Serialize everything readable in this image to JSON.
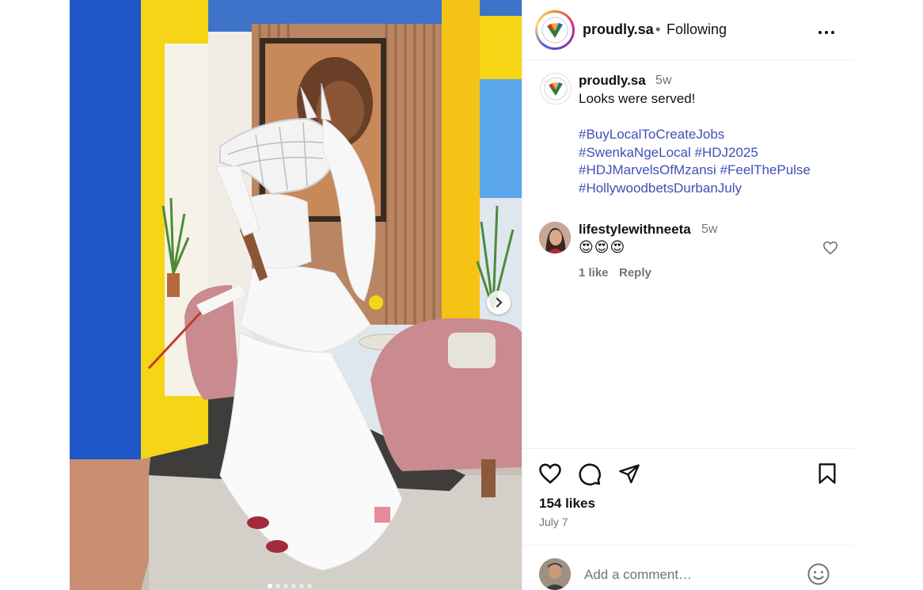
{
  "post": {
    "carousel_dots": 6,
    "active_dot": 0
  },
  "header": {
    "username": "proudly.sa",
    "separator": "•",
    "follow_status": "Following"
  },
  "caption": {
    "username": "proudly.sa",
    "time": "5w",
    "text": "Looks were served!",
    "hashtags": [
      "#BuyLocalToCreateJobs",
      "#SwenkaNgeLocal",
      "#HDJ2025",
      "#HDJMarvelsOfMzansi",
      "#FeelThePulse",
      "#HollywoodbetsDurbanJuly"
    ]
  },
  "comment": {
    "username": "lifestylewithneeta",
    "time": "5w",
    "text": "😍😍😍",
    "likes": "1 like",
    "reply": "Reply"
  },
  "actions": {
    "likes": "154 likes",
    "date": "July 7"
  },
  "add_comment": {
    "placeholder": "Add a comment…"
  },
  "icons": {
    "like": "heart-icon",
    "comment": "comment-icon",
    "share": "send-icon",
    "save": "bookmark-icon",
    "emoji": "emoji-icon",
    "more": "more-icon",
    "next": "chevron-right-icon"
  },
  "colors": {
    "hashtag": "#3f50b5",
    "muted": "#737373",
    "wall_yellow": "#f5d515",
    "wall_blue": "#1f57c9"
  }
}
